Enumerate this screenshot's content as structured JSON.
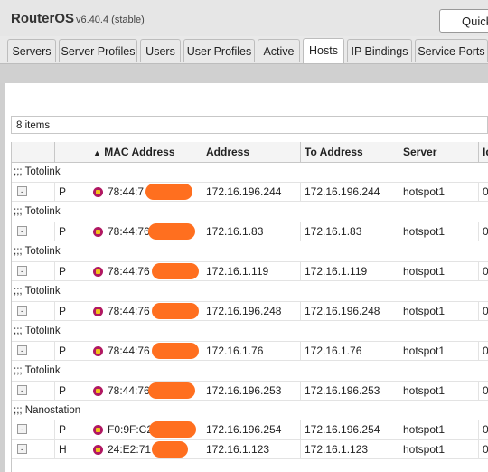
{
  "window": {
    "app_name": "RouterOS",
    "version": "v6.40.4 (stable)",
    "quick_label": "Quick"
  },
  "tabs": [
    {
      "label": "Servers",
      "active": false
    },
    {
      "label": "Server Profiles",
      "active": false
    },
    {
      "label": "Users",
      "active": false
    },
    {
      "label": "User Profiles",
      "active": false
    },
    {
      "label": "Active",
      "active": false
    },
    {
      "label": "Hosts",
      "active": true
    },
    {
      "label": "IP Bindings",
      "active": false
    },
    {
      "label": "Service Ports",
      "active": false
    }
  ],
  "items_count": "8 items",
  "table": {
    "columns": [
      "",
      "",
      "MAC Address",
      "Address",
      "To Address",
      "Server",
      "Id"
    ],
    "sort_indicator": "▲",
    "rows": [
      {
        "comment": ";;; Totolink",
        "flag": "P",
        "mac": "78:44:7",
        "address": "172.16.196.244",
        "to_address": "172.16.196.244",
        "server": "hotspot1",
        "idle": "0"
      },
      {
        "comment": ";;; Totolink",
        "flag": "P",
        "mac": "78:44:76",
        "address": "172.16.1.83",
        "to_address": "172.16.1.83",
        "server": "hotspot1",
        "idle": "0"
      },
      {
        "comment": ";;; Totolink",
        "flag": "P",
        "mac": "78:44:76",
        "address": "172.16.1.119",
        "to_address": "172.16.1.119",
        "server": "hotspot1",
        "idle": "0"
      },
      {
        "comment": ";;; Totolink",
        "flag": "P",
        "mac": "78:44:76",
        "address": "172.16.196.248",
        "to_address": "172.16.196.248",
        "server": "hotspot1",
        "idle": "0"
      },
      {
        "comment": ";;; Totolink",
        "flag": "P",
        "mac": "78:44:76",
        "address": "172.16.1.76",
        "to_address": "172.16.1.76",
        "server": "hotspot1",
        "idle": "0"
      },
      {
        "comment": ";;; Totolink",
        "flag": "P",
        "mac": "78:44:76",
        "address": "172.16.196.253",
        "to_address": "172.16.196.253",
        "server": "hotspot1",
        "idle": "0"
      },
      {
        "comment": ";;; Nanostation",
        "flag": "P",
        "mac": "F0:9F:C2",
        "address": "172.16.196.254",
        "to_address": "172.16.196.254",
        "server": "hotspot1",
        "idle": "0"
      },
      {
        "comment": "",
        "flag": "H",
        "mac": "24:E2:71",
        "address": "172.16.1.123",
        "to_address": "172.16.1.123",
        "server": "hotspot1",
        "idle": "0"
      }
    ]
  },
  "colors": {
    "redaction": "#ff6f1f",
    "active_tab": "#ffffff",
    "host_icon": "#b01862"
  }
}
